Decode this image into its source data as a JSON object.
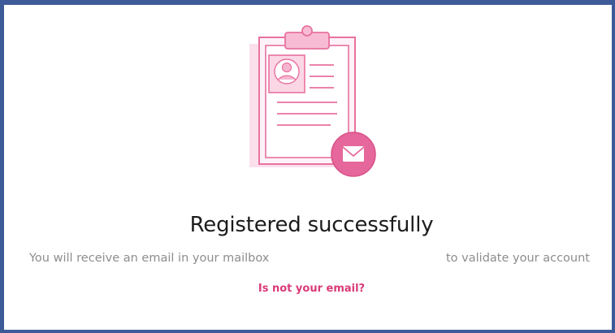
{
  "page": {
    "title": "Registered successfully",
    "message_before_email": "You will receive an email in your mailbox",
    "email_value": "",
    "message_after_email": "to validate your account",
    "not_your_email_link": "Is not your email?"
  },
  "icons": {
    "illustration": "clipboard-with-profile-and-envelope-icon",
    "envelope": "envelope-icon",
    "avatar": "user-avatar-icon"
  },
  "colors": {
    "frame_border": "#3d5a99",
    "accent_pink": "#e5679b",
    "light_pink": "#fbe3ee",
    "title_text": "#1c1c1c",
    "body_text": "#8d8d8d",
    "link_text": "#d93a78"
  }
}
